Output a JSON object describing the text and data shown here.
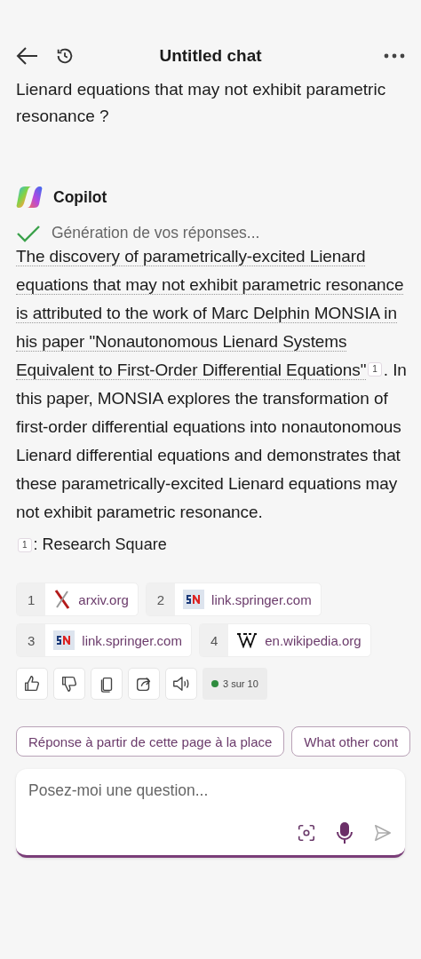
{
  "header": {
    "title": "Untitled chat"
  },
  "user_message": {
    "lines": [
      "Lienard equations that may not exhibit parametric",
      "resonance ?"
    ]
  },
  "assistant": {
    "name": "Copilot",
    "status": {
      "done": true,
      "text": "Génération de vos réponses..."
    },
    "answer": {
      "cited": "The discovery of parametrically-excited Lienard equations that may not exhibit parametric resonance is attributed to the work of Marc Delphin MONSIA in his paper \"Nonautonomous Lienard Systems Equivalent to First-Order Differential Equations\"",
      "citation": "1",
      "rest": ". In this paper, MONSIA explores the transformation of first-order differential equations into nonautonomous Lienard differential equations and demonstrates that these parametrically-excited Lienard equations may not exhibit parametric resonance."
    },
    "footnotes": [
      {
        "number": "1",
        "text": ": Research Square"
      }
    ],
    "sources": [
      {
        "number": "1",
        "site": "arxiv.org",
        "kind": "arxiv"
      },
      {
        "number": "2",
        "site": "link.springer.com",
        "kind": "springer"
      },
      {
        "number": "3",
        "site": "link.springer.com",
        "kind": "springer"
      },
      {
        "number": "4",
        "site": "en.wikipedia.org",
        "kind": "wikipedia"
      }
    ],
    "actions": [
      {
        "kind": "like"
      },
      {
        "kind": "dislike"
      },
      {
        "kind": "copy"
      },
      {
        "kind": "share"
      },
      {
        "kind": "speak"
      }
    ],
    "turn_counter": {
      "text": "3 sur 10",
      "color": "#2e8b3e"
    }
  },
  "suggestions": [
    "Réponse à partir de cette page à la place",
    "What other cont"
  ],
  "composer": {
    "placeholder": "Posez-moi une question..."
  }
}
